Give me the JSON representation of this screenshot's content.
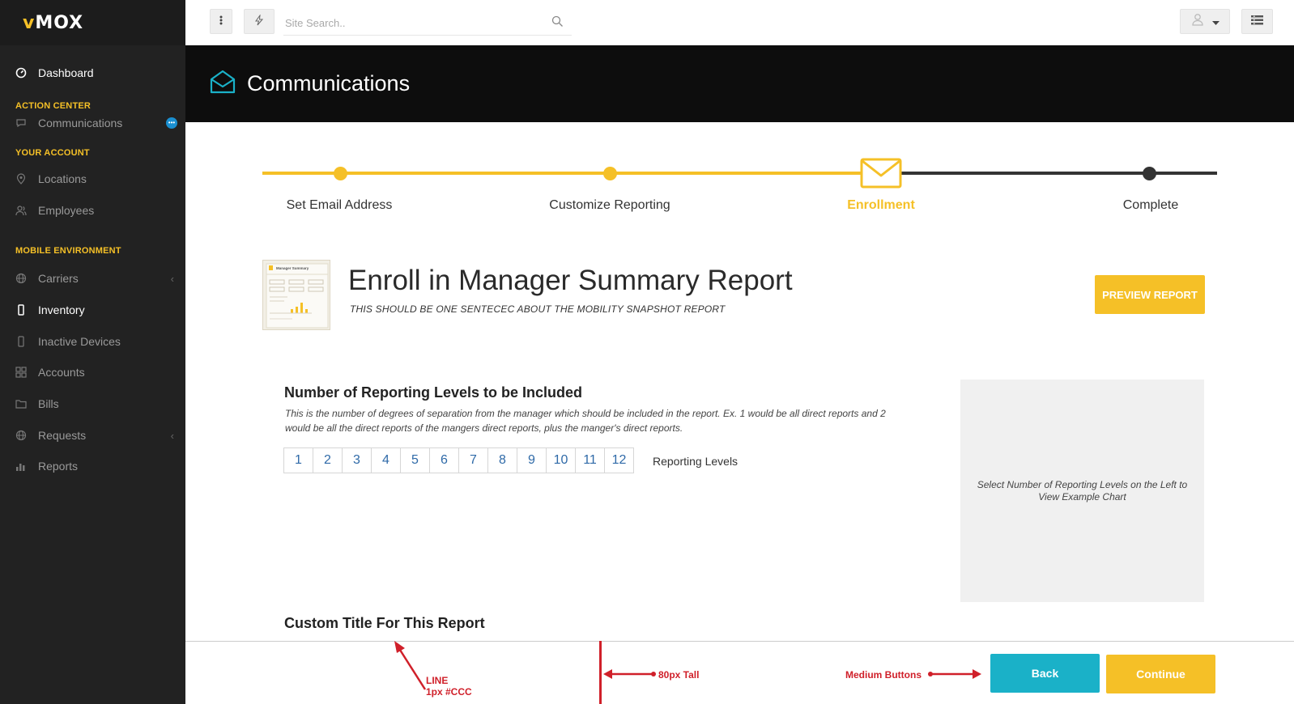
{
  "app": {
    "logo_accent": "v",
    "logo_text": "MOX",
    "accent_color": "#f5c027",
    "secondary_color": "#1ab1c8"
  },
  "sidebar": {
    "dashboard": "Dashboard",
    "section_action_center": "ACTION CENTER",
    "communications": "Communications",
    "communications_badge": "•••",
    "section_your_account": "YOUR ACCOUNT",
    "locations": "Locations",
    "employees": "Employees",
    "section_mobile_environment": "MOBILE ENVIRONMENT",
    "carriers": "Carriers",
    "inventory": "Inventory",
    "inactive_devices": "Inactive Devices",
    "accounts": "Accounts",
    "bills": "Bills",
    "requests": "Requests",
    "reports": "Reports"
  },
  "topbar": {
    "search_placeholder": "Site Search.."
  },
  "header": {
    "title": "Communications",
    "icon": "envelope-open-icon"
  },
  "stepper": {
    "steps": [
      {
        "label": "Set Email Address",
        "state": "done"
      },
      {
        "label": "Customize Reporting",
        "state": "done"
      },
      {
        "label": "Enrollment",
        "state": "current"
      },
      {
        "label": "Complete",
        "state": "pending"
      }
    ]
  },
  "report": {
    "thumbnail_label": "Manager Summary",
    "title": "Enroll in Manager Summary Report",
    "subtitle": "THIS SHOULD BE ONE SENTECEC ABOUT THE MOBILITY SNAPSHOT REPORT",
    "preview_button": "PREVIEW REPORT"
  },
  "levels": {
    "heading": "Number of Reporting Levels to be Included",
    "description": "This is the number of degrees of separation from the manager which should be included in the report.  Ex. 1 would be all direct reports and 2 would be all the direct reports of the mangers direct reports, plus the manger's direct reports.",
    "options": [
      "1",
      "2",
      "3",
      "4",
      "5",
      "6",
      "7",
      "8",
      "9",
      "10",
      "11",
      "12"
    ],
    "label": "Reporting Levels",
    "example_placeholder": "Select Number of Reporting Levels on the Left to View Example Chart"
  },
  "custom_title": {
    "heading": "Custom Title For This Report"
  },
  "footer": {
    "back_button": "Back",
    "continue_button": "Continue"
  },
  "annotations": {
    "line_title": "LINE",
    "line_spec": "1px #CCC",
    "height_note": "80px Tall",
    "buttons_note": "Medium Buttons",
    "color": "#d0202a"
  }
}
